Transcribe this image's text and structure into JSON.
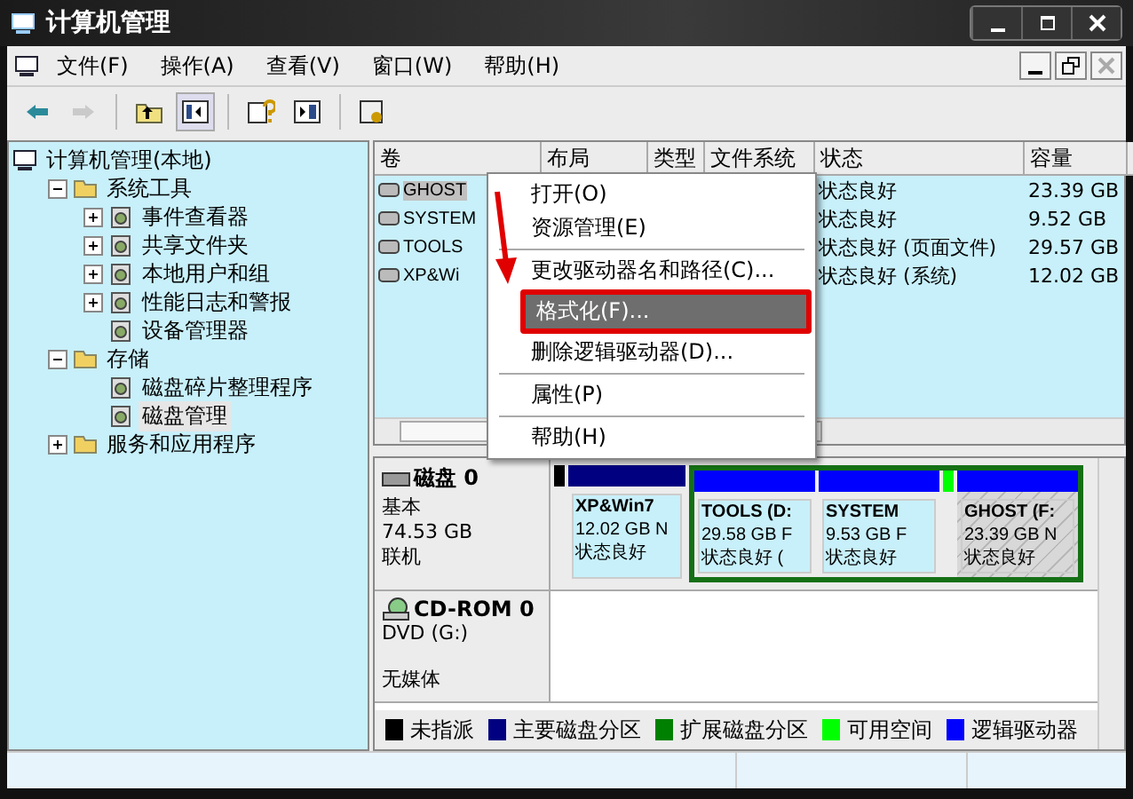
{
  "window": {
    "title": "计算机管理"
  },
  "menu": [
    "文件(F)",
    "操作(A)",
    "查看(V)",
    "窗口(W)",
    "帮助(H)"
  ],
  "toolbar": [
    {
      "kind": "back",
      "disabled": false
    },
    {
      "kind": "forward",
      "disabled": true
    },
    {
      "kind": "sep"
    },
    {
      "kind": "up",
      "disabled": false
    },
    {
      "kind": "tree",
      "disabled": false,
      "selected": true
    },
    {
      "kind": "sep"
    },
    {
      "kind": "help",
      "disabled": false
    },
    {
      "kind": "pane",
      "disabled": false
    },
    {
      "kind": "sep"
    },
    {
      "kind": "props",
      "disabled": false
    }
  ],
  "tree": [
    {
      "label": "计算机管理(本地)",
      "selected": false,
      "children": [
        {
          "label": "系统工具",
          "selected": false,
          "expanded": true,
          "children": [
            {
              "label": "事件查看器",
              "selected": false,
              "expanded": false
            },
            {
              "label": "共享文件夹",
              "selected": false,
              "expanded": false
            },
            {
              "label": "本地用户和组",
              "selected": false,
              "expanded": false
            },
            {
              "label": "性能日志和警报",
              "selected": false,
              "expanded": false
            },
            {
              "label": "设备管理器",
              "selected": false
            }
          ]
        },
        {
          "label": "存储",
          "selected": false,
          "expanded": true,
          "children": [
            {
              "label": "磁盘碎片整理程序",
              "selected": false
            },
            {
              "label": "磁盘管理",
              "selected": true
            }
          ]
        },
        {
          "label": "服务和应用程序",
          "selected": false,
          "expanded": false
        }
      ]
    }
  ],
  "table": {
    "columns": [
      "卷",
      "布局",
      "类型",
      "文件系统",
      "状态",
      "容量"
    ],
    "rows": [
      {
        "volume": "GHOST",
        "status": "状态良好",
        "capacity": "23.39 GB",
        "selected": true
      },
      {
        "volume": "SYSTEM",
        "status": "状态良好",
        "capacity": "9.52 GB",
        "selected": false
      },
      {
        "volume": "TOOLS",
        "status": "状态良好 (页面文件)",
        "capacity": "29.57 GB",
        "selected": false
      },
      {
        "volume": "XP&Wi",
        "status": "状态良好 (系统)",
        "capacity": "12.02 GB",
        "selected": false
      }
    ]
  },
  "context_menu": [
    {
      "kind": "item",
      "label": "打开(O)",
      "selected": false
    },
    {
      "kind": "item",
      "label": "资源管理(E)",
      "selected": false
    },
    {
      "kind": "sep"
    },
    {
      "kind": "item",
      "label": "更改驱动器名和路径(C)...",
      "selected": false
    },
    {
      "kind": "item",
      "label": "格式化(F)...",
      "selected": true,
      "annotated": true
    },
    {
      "kind": "item",
      "label": "删除逻辑驱动器(D)...",
      "selected": false
    },
    {
      "kind": "sep"
    },
    {
      "kind": "item",
      "label": "属性(P)",
      "selected": false
    },
    {
      "kind": "sep"
    },
    {
      "kind": "item",
      "label": "帮助(H)",
      "selected": false
    }
  ],
  "disks": [
    {
      "kind": "disk",
      "name": "磁盘 0",
      "type": "基本",
      "size": "74.53 GB",
      "status": "联机",
      "partitions": [
        {
          "kind": "unallocated"
        },
        {
          "kind": "primary",
          "name": "XP&Win7",
          "size": "12.02 GB N",
          "status": "状态良好",
          "selected": false
        },
        {
          "kind": "extended",
          "children": [
            {
              "kind": "logical",
              "name": "TOOLS (D:",
              "size": "29.58 GB F",
              "status": "状态良好 (",
              "selected": false
            },
            {
              "kind": "logical",
              "name": "SYSTEM",
              "size": "9.53 GB F",
              "status": "状态良好",
              "selected": false
            },
            {
              "kind": "free"
            },
            {
              "kind": "logical",
              "name": "GHOST (F:",
              "size": "23.39 GB N",
              "status": "状态良好",
              "selected": true
            }
          ]
        }
      ]
    },
    {
      "kind": "cdrom",
      "name": "CD-ROM 0",
      "type": "DVD (G:)",
      "status": "无媒体"
    }
  ],
  "legend": [
    {
      "label": "未指派",
      "color": "#000000"
    },
    {
      "label": "主要磁盘分区",
      "color": "#000080"
    },
    {
      "label": "扩展磁盘分区",
      "color": "#008000"
    },
    {
      "label": "可用空间",
      "color": "#00ff00"
    },
    {
      "label": "逻辑驱动器",
      "color": "#0000ff"
    }
  ]
}
